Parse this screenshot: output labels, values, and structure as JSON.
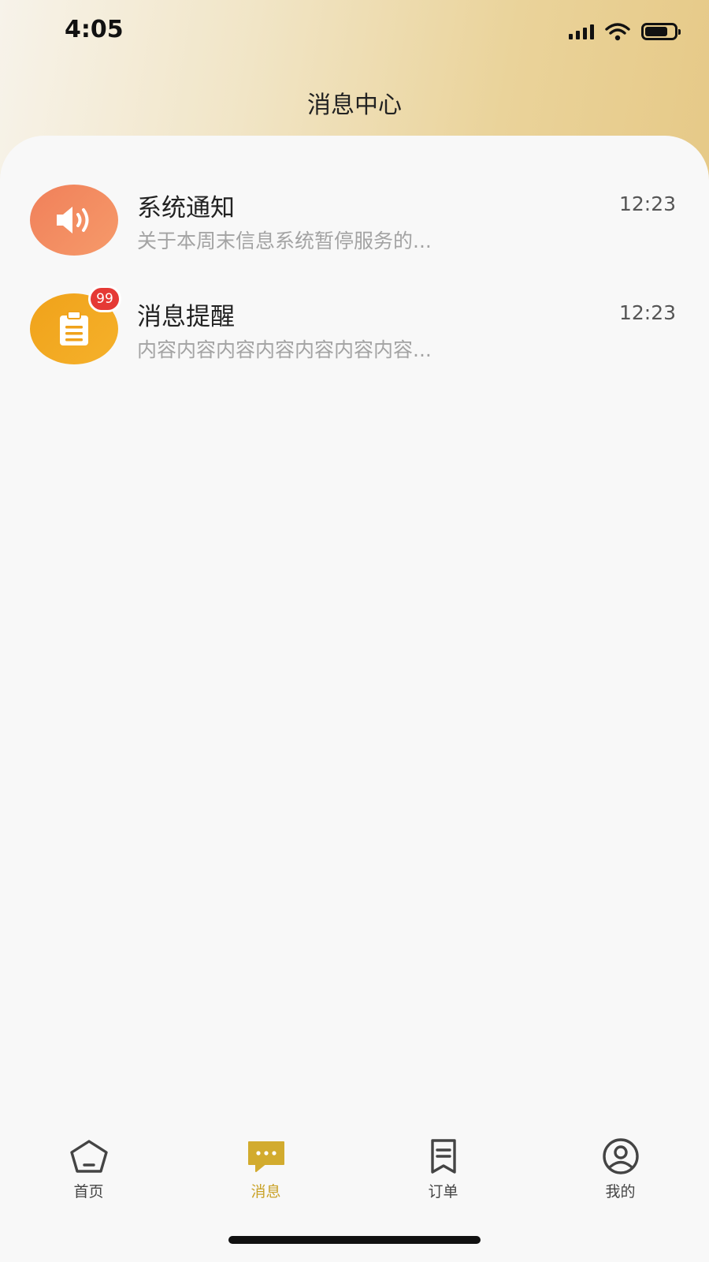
{
  "status_bar": {
    "time": "4:05"
  },
  "header": {
    "title": "消息中心"
  },
  "messages": [
    {
      "title": "系统通知",
      "preview": "关于本周末信息系统暂停服务的...",
      "time": "12:23",
      "icon": "speaker-icon",
      "badge": ""
    },
    {
      "title": "消息提醒",
      "preview": "内容内容内容内容内容内容内容...",
      "time": "12:23",
      "icon": "clipboard-icon",
      "badge": "99"
    }
  ],
  "tabs": [
    {
      "label": "首页",
      "icon": "home-icon",
      "active": false
    },
    {
      "label": "消息",
      "icon": "chat-icon",
      "active": true
    },
    {
      "label": "订单",
      "icon": "order-icon",
      "active": false
    },
    {
      "label": "我的",
      "icon": "profile-icon",
      "active": false
    }
  ],
  "colors": {
    "accent": "#c9a227",
    "badge": "#e53935",
    "avatar_orange": "#f0805a",
    "avatar_yellow": "#f0a21a"
  }
}
